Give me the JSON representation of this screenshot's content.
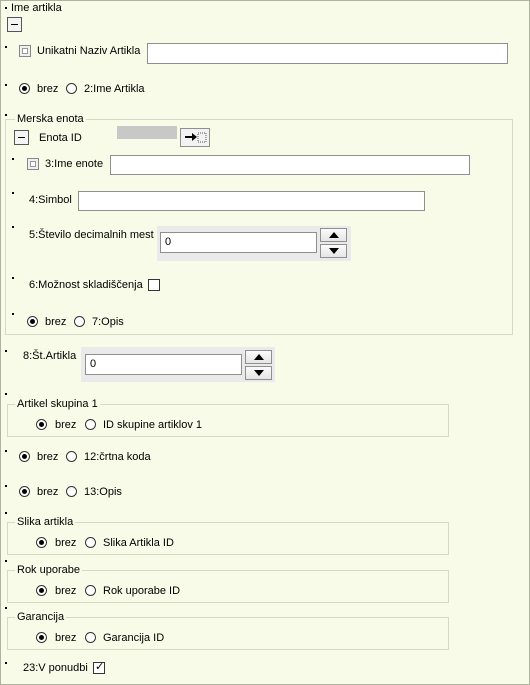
{
  "form": {
    "ime_artikla": {
      "title": "Ime artikla",
      "unikatni_label": "Unikatni Naziv Artikla",
      "unikatni_value": "",
      "opt_brez": "brez",
      "opt_ime": "2:Ime Artikla"
    },
    "merska_enota": {
      "title": "Merska enota",
      "enota_id_label": "Enota ID",
      "ime_enote_label": "3:Ime enote",
      "ime_enote_value": "",
      "simbol_label": "4:Simbol",
      "simbol_value": "",
      "decimal_label": "5:Število decimalnih mest",
      "decimal_value": "0",
      "skladiscenje_label": "6:Možnost skladiščenja",
      "opt_brez": "brez",
      "opt_opis": "7:Opis"
    },
    "st_artikla": {
      "label": "8:Št.Artikla",
      "value": "0"
    },
    "artikel_skupina": {
      "title": "Artikel skupina 1",
      "opt_brez": "brez",
      "opt_id": "ID skupine artiklov 1"
    },
    "crtna_koda": {
      "opt_brez": "brez",
      "opt_koda": "12:črtna koda"
    },
    "opis": {
      "opt_brez": "brez",
      "opt_opis": "13:Opis"
    },
    "slika": {
      "title": "Slika artikla",
      "opt_brez": "brez",
      "opt_id": "Slika Artikla ID"
    },
    "rok": {
      "title": "Rok uporabe",
      "opt_brez": "brez",
      "opt_id": "Rok uporabe ID"
    },
    "garancija": {
      "title": "Garancija",
      "opt_brez": "brez",
      "opt_id": "Garancija ID"
    },
    "v_ponudbi": {
      "label": "23:V ponudbi",
      "checked": true
    }
  }
}
